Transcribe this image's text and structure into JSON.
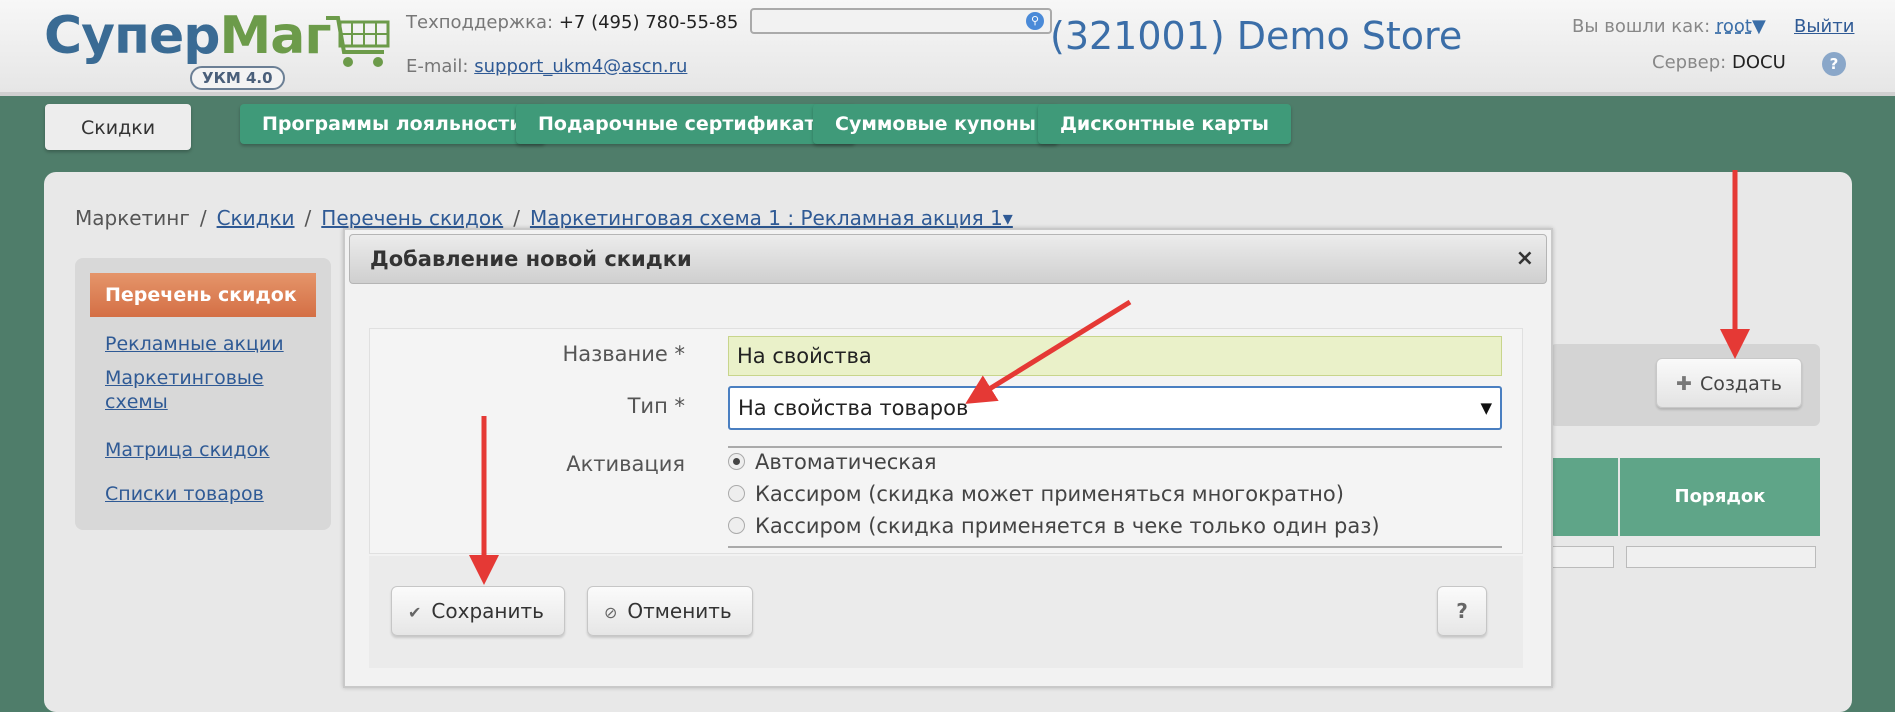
{
  "header": {
    "logo_part1": "Супер",
    "logo_part2": "Маг",
    "logo_badge": "УКМ 4.0",
    "support_label": "Техподдержка:",
    "support_phone": "+7 (495) 780-55-85",
    "email_label": "E-mail:",
    "email_value": "support_ukm4@ascn.ru",
    "search_placeholder": "",
    "store_name": "(321001) Demo Store",
    "login_label": "Вы вошли как:",
    "login_user": "root",
    "logout": "Выйти",
    "server_label": "Сервер:",
    "server_value": "DOCU",
    "help": "?"
  },
  "tabs": [
    {
      "label": "Скидки",
      "active": true
    },
    {
      "label": "Программы лояльности"
    },
    {
      "label": "Подарочные сертификаты"
    },
    {
      "label": "Суммовые купоны"
    },
    {
      "label": "Дисконтные карты"
    }
  ],
  "breadcrumb": {
    "root": "Маркетинг",
    "items": [
      "Скидки",
      "Перечень скидок",
      "Маркетинговая схема 1 : Рекламная акция 1▾"
    ],
    "separator": "/"
  },
  "sidebar": {
    "active": "Перечень скидок",
    "links": [
      "Рекламные акции",
      "Маркетинговые схемы",
      "Матрица скидок",
      "Списки товаров"
    ]
  },
  "main": {
    "create_button": "Создать",
    "create_icon": "plus-icon",
    "column_header": "Порядок"
  },
  "modal": {
    "title": "Добавление новой скидки",
    "close": "×",
    "name_label": "Название *",
    "name_value": "На свойства",
    "type_label": "Тип *",
    "type_value": "На свойства товаров",
    "activation_label": "Активация",
    "activation_options": [
      "Автоматическая",
      "Кассиром (скидка может применяться многократно)",
      "Кассиром (скидка применяется в чеке только один раз)"
    ],
    "activation_selected": 0,
    "save": "Сохранить",
    "cancel": "Отменить",
    "help": "?"
  },
  "colors": {
    "background": "#4f7d6a",
    "tab": "#3f9a79",
    "accent_orange": "#d46f45",
    "link": "#2f5a95",
    "arrow": "#e53935"
  }
}
